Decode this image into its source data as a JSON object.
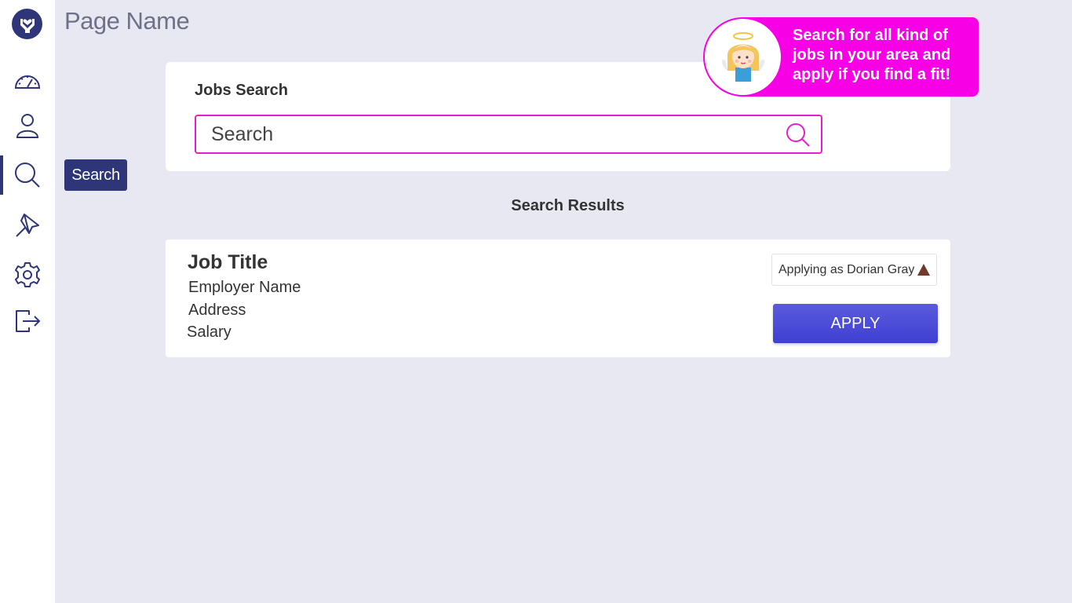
{
  "page": {
    "title": "Page Name"
  },
  "sidebar": {
    "items": [
      {
        "name": "dashboard",
        "icon": "speedometer-icon"
      },
      {
        "name": "profile",
        "icon": "user-icon"
      },
      {
        "name": "search",
        "icon": "search-icon",
        "active": true
      },
      {
        "name": "pinned",
        "icon": "pin-icon"
      },
      {
        "name": "settings",
        "icon": "gear-icon"
      },
      {
        "name": "logout",
        "icon": "logout-icon"
      }
    ],
    "tooltip": "Search"
  },
  "search": {
    "title": "Jobs Search",
    "placeholder": "Search",
    "value": ""
  },
  "callout": {
    "text": "Search for all kind of jobs in your area and apply if you find a fit!"
  },
  "results": {
    "title": "Search Results",
    "items": [
      {
        "job_title": "Job Title",
        "employer": "Employer Name",
        "address": "Address",
        "salary": "Salary",
        "applying_as": "Applying as Dorian Gray",
        "apply_label": "APPLY"
      }
    ]
  },
  "colors": {
    "primary": "#2e3578",
    "accent": "#f800e6",
    "button": "#4a4bd8",
    "background": "#e8e8f2"
  }
}
